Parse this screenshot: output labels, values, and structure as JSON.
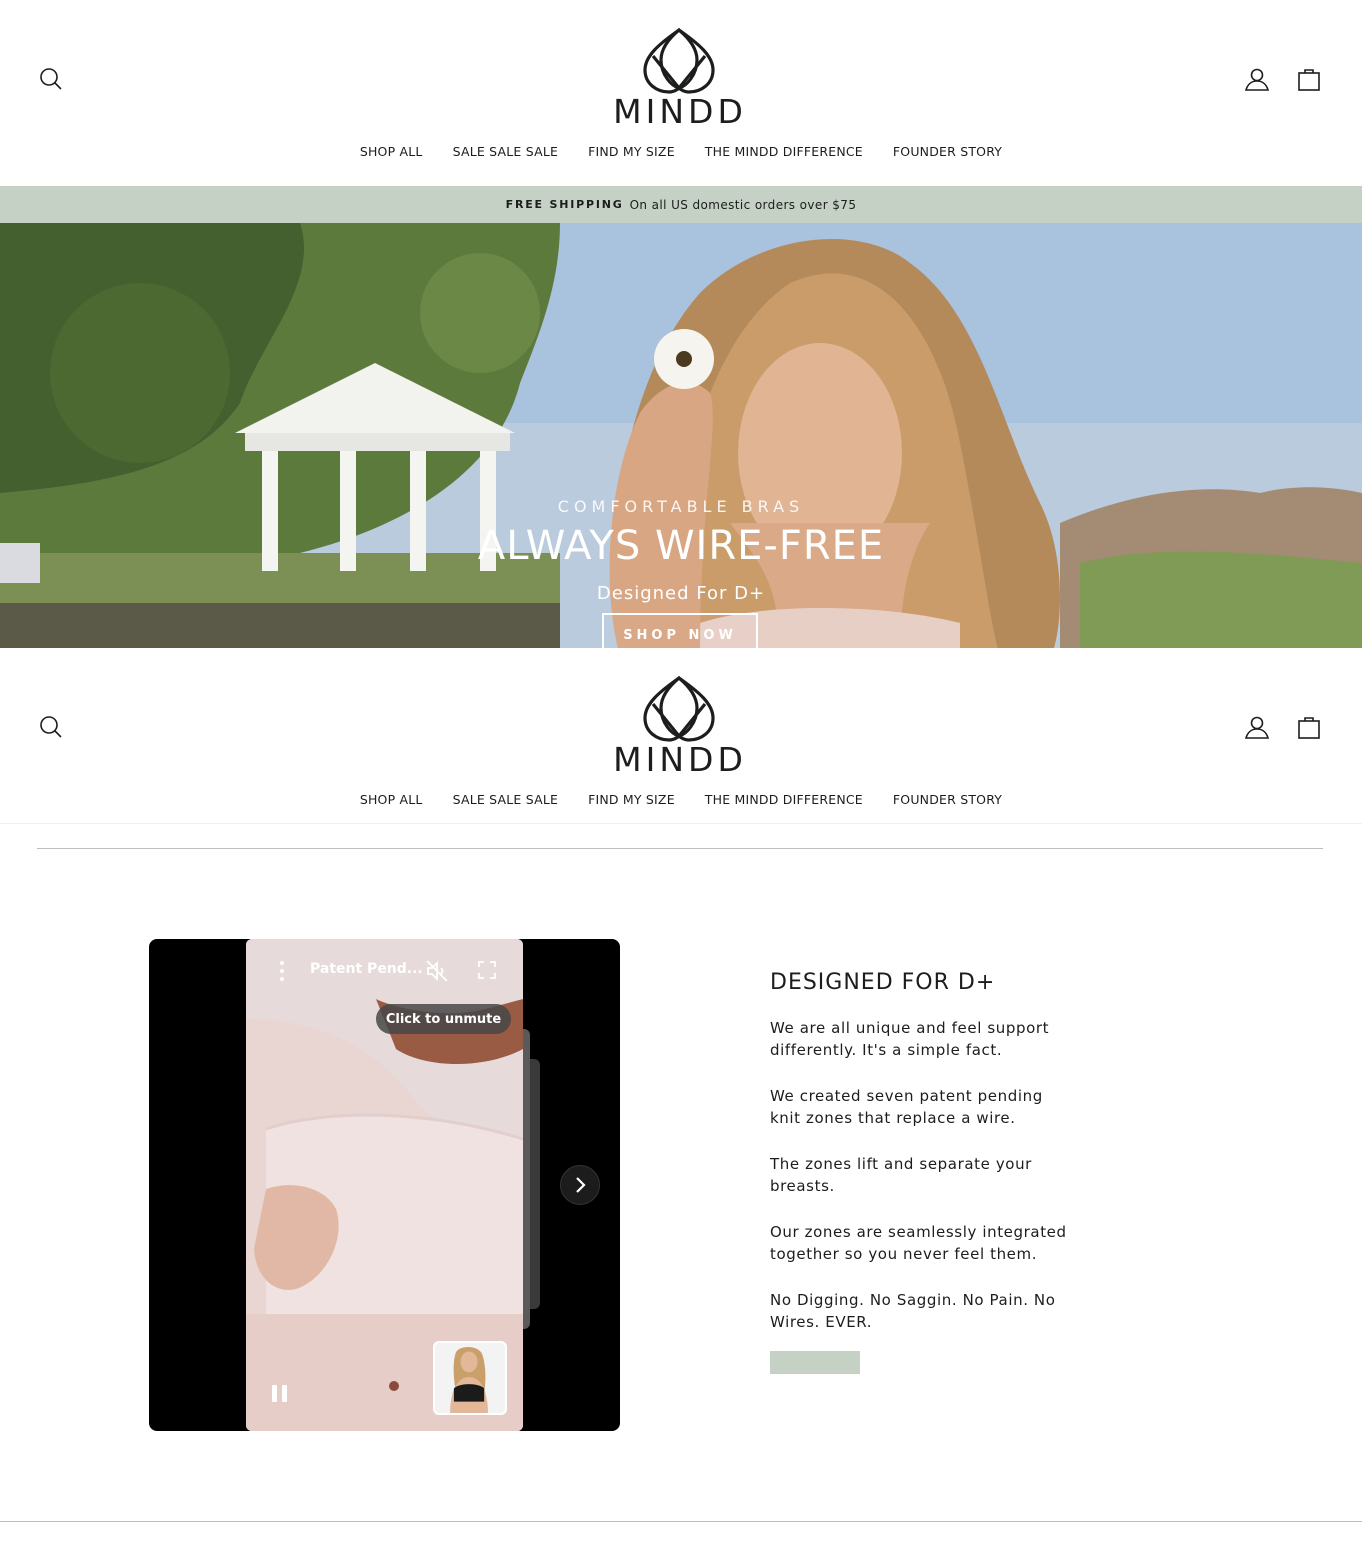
{
  "header": {
    "logo_text": "MINDD",
    "nav": [
      "SHOP ALL",
      "SALE SALE SALE",
      "FIND MY SIZE",
      "THE MINDD DIFFERENCE",
      "FOUNDER STORY"
    ]
  },
  "announcement": {
    "strong": "FREE SHIPPING",
    "message": "On all US domestic orders over $75"
  },
  "hero": {
    "subtitle": "COMFORTABLE BRAS",
    "title": "ALWAYS WIRE-FREE",
    "tagline": "Designed For D+",
    "button": "SHOP NOW"
  },
  "video": {
    "title": "Patent Pend...",
    "unmute_label": "Click to unmute",
    "icons": [
      "more-vertical-icon",
      "muted-speaker-icon",
      "fullscreen-icon",
      "pause-icon",
      "chevron-right-icon"
    ]
  },
  "feature": {
    "heading": "DESIGNED FOR D+",
    "paragraphs": [
      "We are all unique and feel support differently. It's a simple fact.",
      "We created seven patent pending knit zones that replace a wire.",
      "The zones lift and separate your breasts.",
      "Our zones are seamlessly integrated together so you never feel them.",
      "No Digging. No Saggin. No Pain. No Wires. EVER."
    ]
  },
  "colors": {
    "accent": "#c6d1c6",
    "text": "#1c1d1d"
  }
}
